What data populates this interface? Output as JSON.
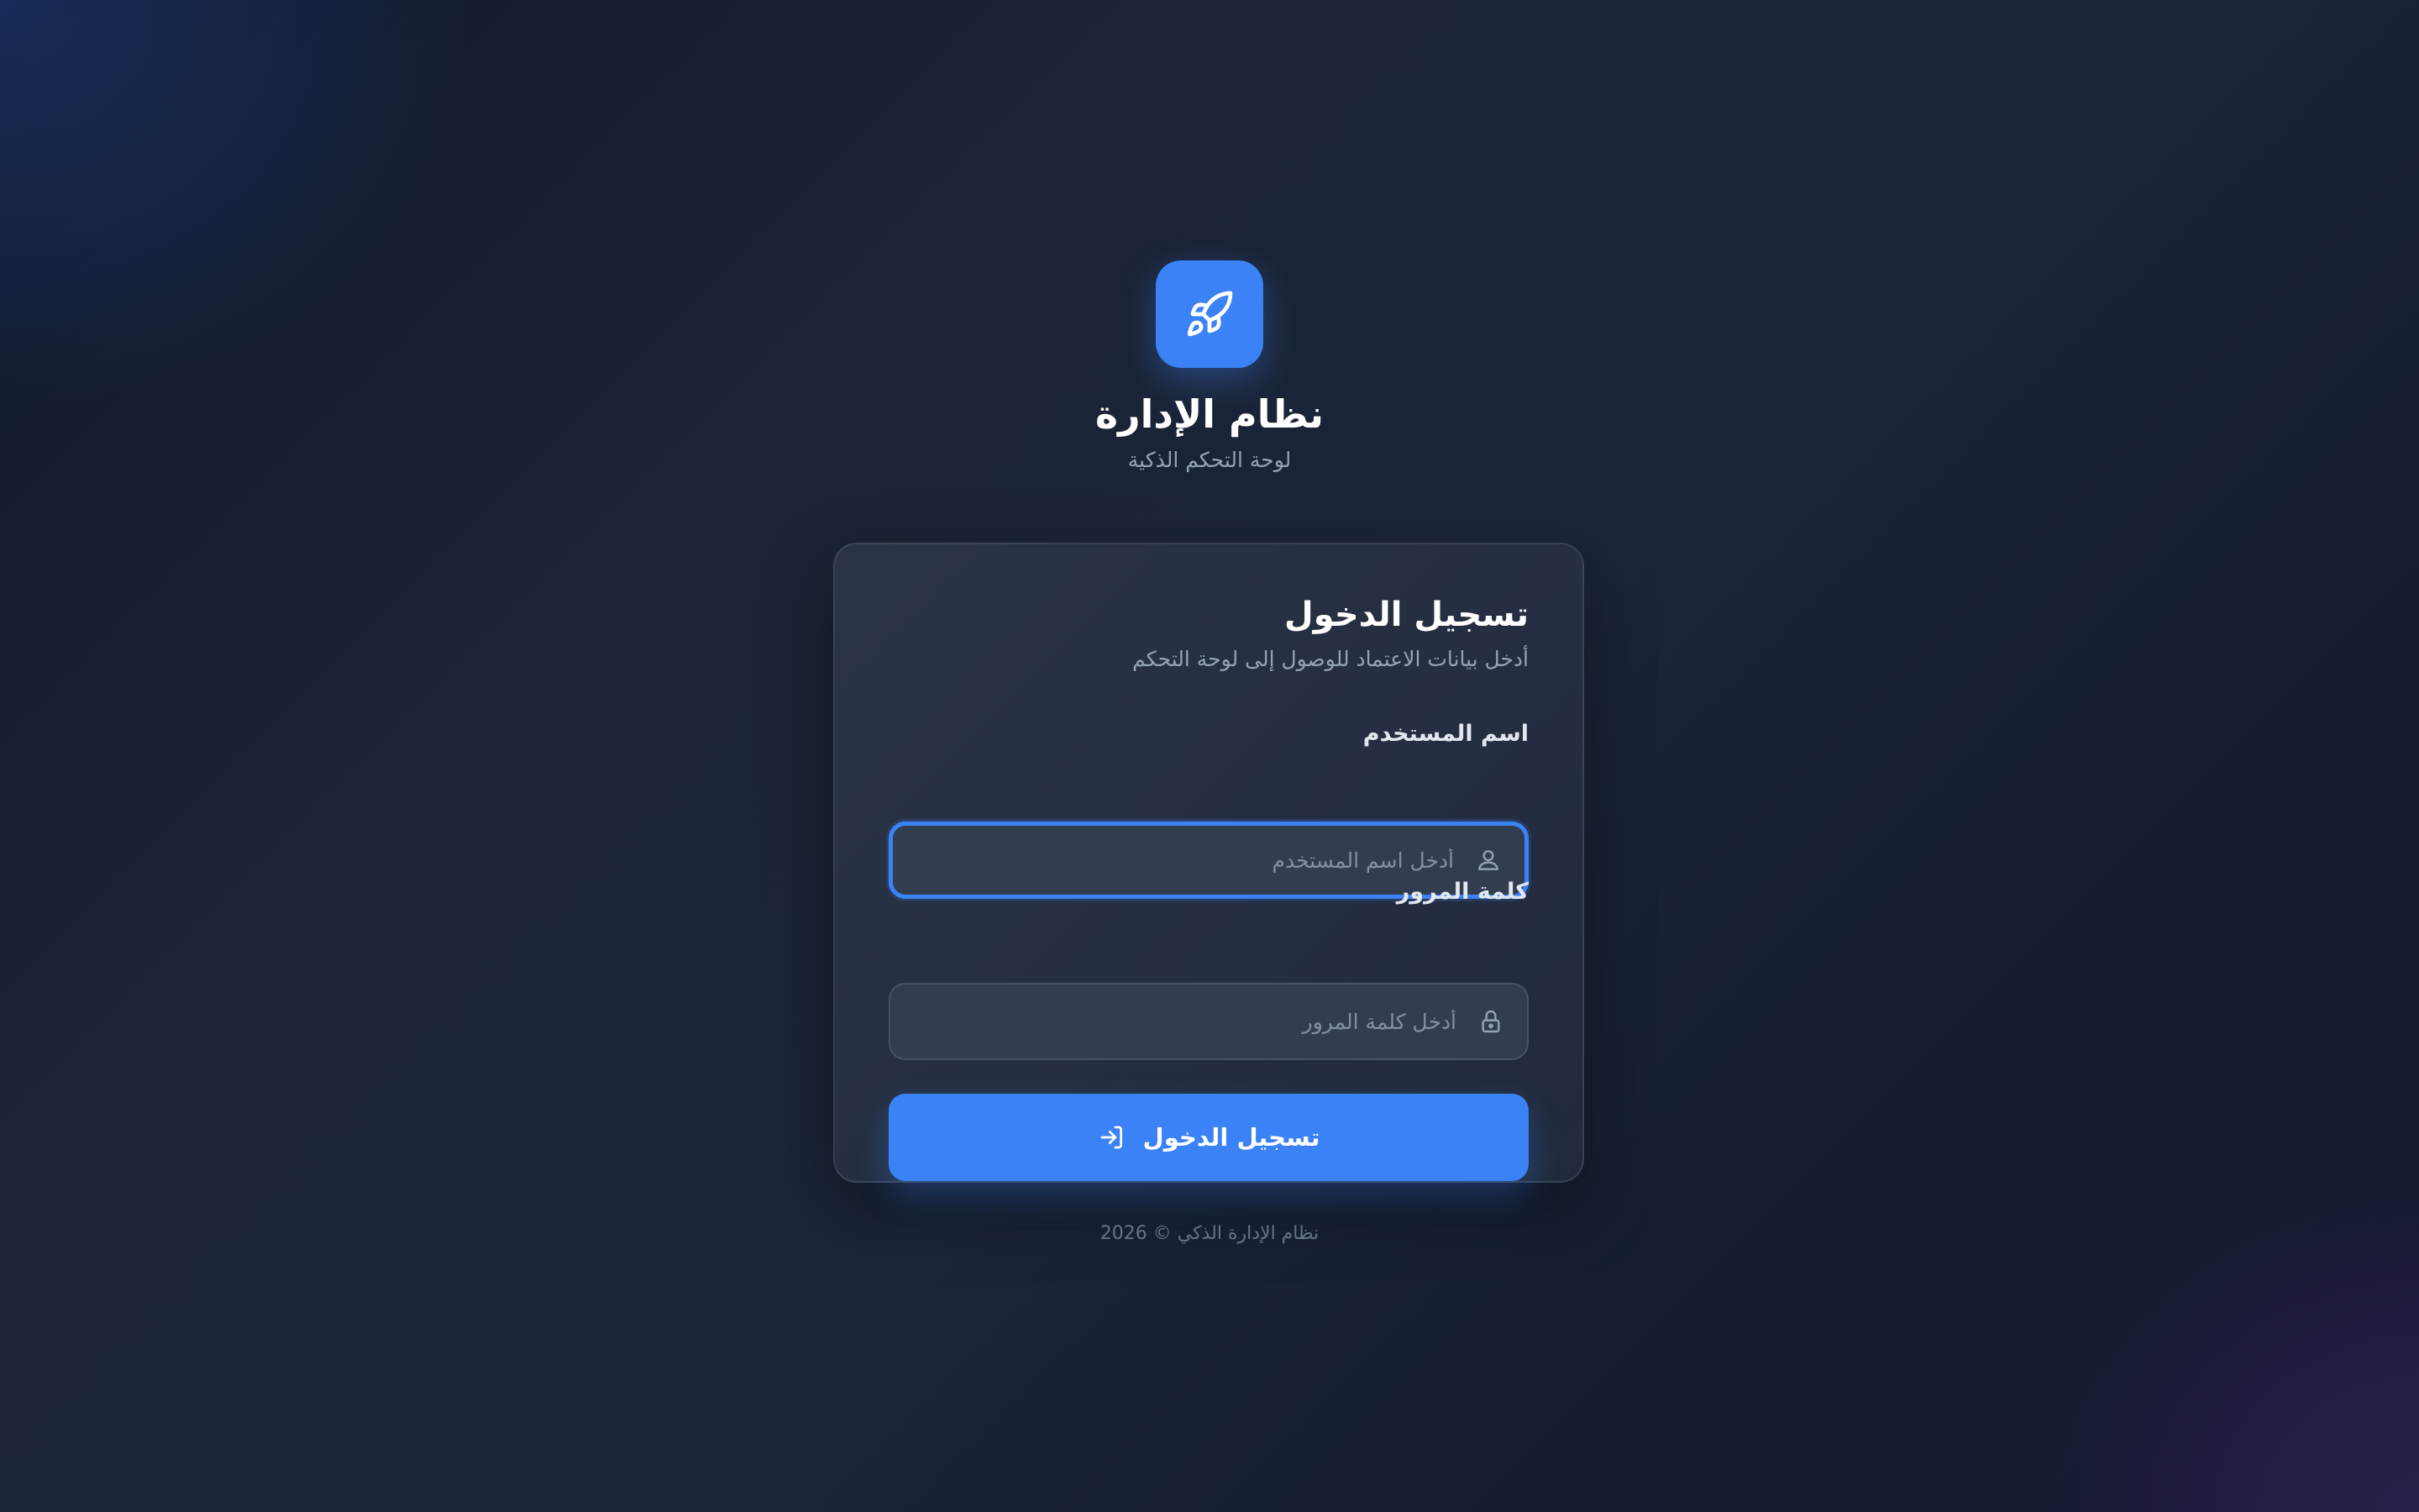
{
  "brand": {
    "logo_icon": "rocket-icon",
    "title": "نظام الإدارة",
    "subtitle": "لوحة التحكم الذكية"
  },
  "login_card": {
    "title": "تسجيل الدخول",
    "description": "أدخل بيانات الاعتماد للوصول إلى لوحة التحكم",
    "username": {
      "label": "اسم المستخدم",
      "placeholder": "أدخل اسم المستخدم",
      "value": "",
      "icon": "user-icon",
      "focused": true
    },
    "password": {
      "label": "كلمة المرور",
      "placeholder": "أدخل كلمة المرور",
      "value": "",
      "icon": "lock-icon"
    },
    "submit": {
      "label": "تسجيل الدخول",
      "icon": "login-icon"
    }
  },
  "footer": {
    "text": "نظام الإدارة الذكي © 2026"
  },
  "colors": {
    "accent": "#3b82f6",
    "background": "#1a2336",
    "card": "#2b3548",
    "input": "#323d50"
  }
}
